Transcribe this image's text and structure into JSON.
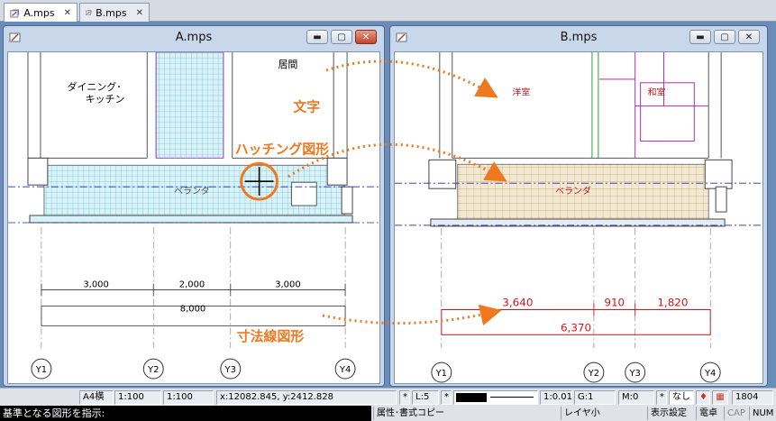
{
  "tabs": [
    {
      "label": "A.mps"
    },
    {
      "label": "B.mps"
    }
  ],
  "windowA": {
    "title": "A.mps",
    "rooms": {
      "kitchen_line1": "ダイニング･",
      "kitchen_line2": "キッチン",
      "living": "居間",
      "veranda": "ベランダ"
    },
    "dims": {
      "d1": "3,000",
      "d2": "2,000",
      "d3": "3,000",
      "total": "8,000"
    },
    "axes": [
      "Y1",
      "Y2",
      "Y3",
      "Y4"
    ]
  },
  "windowB": {
    "title": "B.mps",
    "rooms": {
      "western": "洋室",
      "japanese": "和室",
      "veranda": "ベランダ"
    },
    "dims": {
      "d1": "3,640",
      "d2": "910",
      "d3": "1,820",
      "total": "6,370"
    },
    "axes": [
      "Y1",
      "Y2",
      "Y3",
      "Y4"
    ]
  },
  "annotations": {
    "text": "文字",
    "hatch": "ハッチング図形",
    "dimension": "寸法線図形"
  },
  "colors": {
    "accent": "#f0781e",
    "cyan_hatch": "#2aa8c8",
    "tan_hatch": "#c9a96b",
    "dim_red": "#d4141c"
  },
  "status": {
    "paper": "A4横",
    "scale1": "1:100",
    "scale2": "1:100",
    "coords": "x:12082.845, y:2412.828",
    "star": "*",
    "layer": "L:5",
    "star2": "*",
    "ratio": "1:0.01",
    "grid": "G:1",
    "mode": "M:0",
    "star3": "*",
    "none": "なし",
    "count": "1804"
  },
  "command": {
    "prompt": "基準となる図形を指示:",
    "f1": "属性･書式コピー",
    "f2": "レイヤ小",
    "f3": "表示設定",
    "f4": "電卓",
    "f5": "CAP",
    "f6": "NUM"
  }
}
